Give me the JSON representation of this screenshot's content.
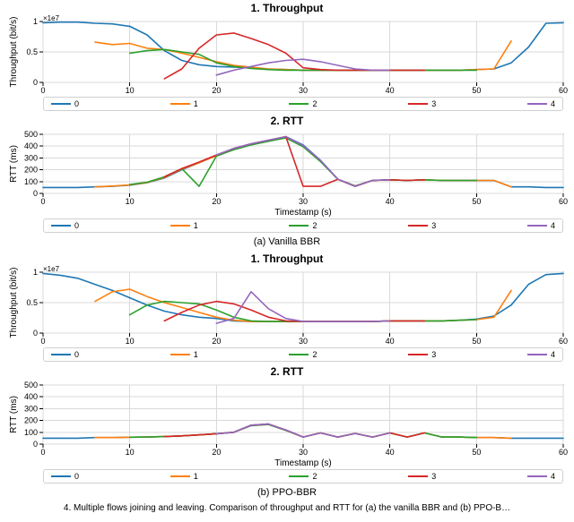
{
  "colors": {
    "s0": "#1f77b4",
    "s1": "#ff7f0e",
    "s2": "#2ca02c",
    "s3": "#d62728",
    "s4": "#9467bd"
  },
  "subcaptions": {
    "a": "(a) Vanilla BBR",
    "b": "(b) PPO-BBR"
  },
  "truncated_line": "4.  Multiple flows joining and leaving.  Comparison of throughput and RTT for (a) the vanilla BBR and (b) PPO-B…",
  "axes": {
    "x_label": "Timestamp (s)",
    "throughput_label": "Throughput (bit/s)",
    "rtt_label": "RTT (ms)",
    "throughput_exp": "1e7"
  },
  "legend_labels": [
    "0",
    "1",
    "2",
    "3",
    "4"
  ],
  "chart_data": [
    {
      "id": "vanilla-throughput",
      "title": "1. Throughput",
      "type": "line",
      "xlabel": "",
      "ylabel": "Throughput (bit/s)",
      "ylim": [
        0,
        10000000
      ],
      "xlim": [
        0,
        60
      ],
      "y_note": "×1e7",
      "x": [
        0,
        2,
        4,
        6,
        8,
        10,
        12,
        14,
        16,
        18,
        20,
        22,
        24,
        26,
        28,
        30,
        32,
        34,
        36,
        38,
        40,
        42,
        44,
        46,
        48,
        50,
        52,
        54,
        56,
        58,
        60
      ],
      "series": [
        {
          "name": "0",
          "color": "s0",
          "values": [
            9.8,
            9.9,
            9.9,
            9.7,
            9.6,
            9.2,
            7.8,
            5.2,
            3.6,
            2.9,
            2.6,
            2.5,
            2.4,
            2.2,
            2.1,
            2.0,
            2.0,
            2.0,
            2.0,
            2.0,
            2.0,
            2.0,
            2.0,
            2.0,
            2.0,
            2.1,
            2.2,
            3.2,
            5.8,
            9.7,
            9.8
          ],
          "scale": 1000000.0
        },
        {
          "name": "1",
          "color": "s1",
          "values": [
            null,
            null,
            null,
            6.6,
            6.2,
            6.4,
            5.6,
            5.4,
            4.8,
            4.1,
            3.4,
            2.8,
            2.5,
            2.2,
            2.1,
            2.0,
            2.0,
            2.0,
            2.0,
            2.0,
            2.0,
            2.0,
            2.0,
            2.0,
            2.0,
            2.1,
            2.2,
            6.8,
            null,
            null,
            null
          ],
          "scale": 1000000.0
        },
        {
          "name": "2",
          "color": "s2",
          "values": [
            null,
            null,
            null,
            null,
            null,
            4.8,
            5.2,
            5.4,
            5.0,
            4.6,
            3.2,
            2.6,
            2.3,
            2.1,
            2.0,
            2.0,
            2.0,
            2.0,
            2.0,
            2.0,
            2.0,
            2.0,
            2.0,
            2.0,
            2.0,
            2.0,
            null,
            null,
            null,
            null,
            null
          ],
          "scale": 1000000.0
        },
        {
          "name": "3",
          "color": "s3",
          "values": [
            null,
            null,
            null,
            null,
            null,
            null,
            null,
            0.6,
            2.2,
            5.6,
            7.8,
            8.1,
            7.2,
            6.2,
            4.8,
            2.4,
            2.1,
            2.0,
            2.0,
            2.0,
            2.0,
            2.0,
            2.0,
            null,
            null,
            null,
            null,
            null,
            null,
            null,
            null
          ],
          "scale": 1000000.0
        },
        {
          "name": "4",
          "color": "s4",
          "values": [
            null,
            null,
            null,
            null,
            null,
            null,
            null,
            null,
            null,
            null,
            1.2,
            2.0,
            2.6,
            3.2,
            3.6,
            3.8,
            3.4,
            2.8,
            2.2,
            2.0,
            2.0,
            null,
            null,
            null,
            null,
            null,
            null,
            null,
            null,
            null,
            null
          ],
          "scale": 1000000.0
        }
      ],
      "yticks": [
        0,
        0.5,
        1.0
      ],
      "ytick_scale": 10000000.0
    },
    {
      "id": "vanilla-rtt",
      "title": "2. RTT",
      "type": "line",
      "xlabel": "Timestamp (s)",
      "ylabel": "RTT (ms)",
      "ylim": [
        0,
        500
      ],
      "xlim": [
        0,
        60
      ],
      "x": [
        0,
        2,
        4,
        6,
        8,
        10,
        12,
        14,
        16,
        18,
        20,
        22,
        24,
        26,
        28,
        30,
        32,
        34,
        36,
        38,
        40,
        42,
        44,
        46,
        48,
        50,
        52,
        54,
        56,
        58,
        60
      ],
      "series": [
        {
          "name": "0",
          "color": "s0",
          "values": [
            50,
            50,
            50,
            55,
            60,
            70,
            90,
            130,
            200,
            260,
            320,
            380,
            420,
            450,
            480,
            410,
            280,
            120,
            60,
            110,
            115,
            110,
            115,
            110,
            110,
            110,
            110,
            55,
            55,
            50,
            50
          ]
        },
        {
          "name": "1",
          "color": "s1",
          "values": [
            null,
            null,
            null,
            55,
            62,
            72,
            92,
            135,
            205,
            260,
            320,
            375,
            415,
            445,
            475,
            400,
            275,
            120,
            62,
            110,
            115,
            110,
            115,
            110,
            110,
            110,
            110,
            55,
            null,
            null,
            null
          ]
        },
        {
          "name": "2",
          "color": "s2",
          "values": [
            null,
            null,
            null,
            null,
            null,
            75,
            95,
            140,
            210,
            60,
            315,
            370,
            410,
            440,
            470,
            395,
            270,
            120,
            64,
            110,
            115,
            110,
            115,
            110,
            110,
            110,
            null,
            null,
            null,
            null,
            null
          ]
        },
        {
          "name": "3",
          "color": "s3",
          "values": [
            null,
            null,
            null,
            null,
            null,
            null,
            null,
            140,
            210,
            265,
            325,
            380,
            420,
            450,
            480,
            60,
            60,
            120,
            60,
            110,
            115,
            110,
            115,
            null,
            null,
            null,
            null,
            null,
            null,
            null,
            null
          ]
        },
        {
          "name": "4",
          "color": "s4",
          "values": [
            null,
            null,
            null,
            null,
            null,
            null,
            null,
            null,
            null,
            null,
            325,
            380,
            420,
            450,
            480,
            405,
            280,
            120,
            60,
            110,
            115,
            null,
            null,
            null,
            null,
            null,
            null,
            null,
            null,
            null,
            null
          ]
        }
      ],
      "yticks": [
        0,
        100,
        200,
        300,
        400,
        500
      ]
    },
    {
      "id": "ppo-throughput",
      "title": "1. Throughput",
      "type": "line",
      "xlabel": "",
      "ylabel": "Throughput (bit/s)",
      "ylim": [
        0,
        10000000
      ],
      "xlim": [
        0,
        60
      ],
      "y_note": "×1e7",
      "x": [
        0,
        2,
        4,
        6,
        8,
        10,
        12,
        14,
        16,
        18,
        20,
        22,
        24,
        26,
        28,
        30,
        32,
        34,
        36,
        38,
        40,
        42,
        44,
        46,
        48,
        50,
        52,
        54,
        56,
        58,
        60
      ],
      "series": [
        {
          "name": "0",
          "color": "s0",
          "values": [
            9.8,
            9.5,
            9.0,
            8.0,
            7.0,
            5.8,
            4.6,
            3.6,
            3.0,
            2.6,
            2.4,
            2.0,
            1.9,
            1.9,
            1.9,
            1.9,
            1.9,
            1.9,
            1.9,
            1.9,
            2.0,
            2.0,
            2.0,
            2.0,
            2.1,
            2.3,
            2.8,
            4.6,
            8.0,
            9.6,
            9.8
          ],
          "scale": 1000000.0
        },
        {
          "name": "1",
          "color": "s1",
          "values": [
            null,
            null,
            null,
            5.2,
            6.8,
            7.2,
            6.0,
            5.0,
            4.2,
            3.4,
            2.6,
            2.1,
            1.9,
            1.9,
            1.9,
            1.9,
            1.9,
            1.9,
            1.9,
            1.9,
            2.0,
            2.0,
            2.0,
            2.0,
            2.1,
            2.2,
            2.6,
            7.0,
            null,
            null,
            null
          ],
          "scale": 1000000.0
        },
        {
          "name": "2",
          "color": "s2",
          "values": [
            null,
            null,
            null,
            null,
            null,
            3.0,
            4.6,
            5.2,
            5.0,
            4.8,
            3.8,
            2.6,
            2.0,
            1.9,
            1.9,
            1.9,
            1.9,
            1.9,
            1.9,
            1.9,
            2.0,
            2.0,
            2.0,
            2.0,
            2.1,
            2.2,
            null,
            null,
            null,
            null,
            null
          ],
          "scale": 1000000.0
        },
        {
          "name": "3",
          "color": "s3",
          "values": [
            null,
            null,
            null,
            null,
            null,
            null,
            null,
            2.0,
            3.4,
            4.6,
            5.2,
            4.8,
            3.8,
            2.6,
            2.0,
            1.9,
            1.9,
            1.9,
            1.9,
            1.9,
            2.0,
            2.0,
            2.0,
            null,
            null,
            null,
            null,
            null,
            null,
            null,
            null
          ],
          "scale": 1000000.0
        },
        {
          "name": "4",
          "color": "s4",
          "values": [
            null,
            null,
            null,
            null,
            null,
            null,
            null,
            null,
            null,
            null,
            1.6,
            2.4,
            6.8,
            4.0,
            2.4,
            1.9,
            1.9,
            1.9,
            1.9,
            1.9,
            2.0,
            null,
            null,
            null,
            null,
            null,
            null,
            null,
            null,
            null,
            null
          ],
          "scale": 1000000.0
        }
      ],
      "yticks": [
        0,
        0.5,
        1.0
      ],
      "ytick_scale": 10000000.0
    },
    {
      "id": "ppo-rtt",
      "title": "2. RTT",
      "type": "line",
      "xlabel": "Timestamp (s)",
      "ylabel": "RTT (ms)",
      "ylim": [
        0,
        500
      ],
      "xlim": [
        0,
        60
      ],
      "x": [
        0,
        2,
        4,
        6,
        8,
        10,
        12,
        14,
        16,
        18,
        20,
        22,
        24,
        26,
        28,
        30,
        32,
        34,
        36,
        38,
        40,
        42,
        44,
        46,
        48,
        50,
        52,
        54,
        56,
        58,
        60
      ],
      "series": [
        {
          "name": "0",
          "color": "s0",
          "values": [
            50,
            50,
            50,
            55,
            55,
            58,
            60,
            64,
            70,
            78,
            88,
            100,
            160,
            170,
            120,
            60,
            95,
            60,
            90,
            60,
            95,
            60,
            95,
            60,
            60,
            55,
            55,
            50,
            50,
            50,
            50
          ]
        },
        {
          "name": "1",
          "color": "s1",
          "values": [
            null,
            null,
            null,
            55,
            55,
            58,
            60,
            64,
            70,
            78,
            88,
            100,
            158,
            168,
            118,
            60,
            95,
            60,
            90,
            60,
            95,
            60,
            95,
            60,
            60,
            55,
            55,
            50,
            null,
            null,
            null
          ]
        },
        {
          "name": "2",
          "color": "s2",
          "values": [
            null,
            null,
            null,
            null,
            null,
            58,
            60,
            64,
            70,
            78,
            88,
            100,
            156,
            166,
            116,
            60,
            95,
            60,
            90,
            60,
            95,
            60,
            95,
            60,
            60,
            55,
            null,
            null,
            null,
            null,
            null
          ]
        },
        {
          "name": "3",
          "color": "s3",
          "values": [
            null,
            null,
            null,
            null,
            null,
            null,
            null,
            64,
            70,
            78,
            88,
            100,
            160,
            170,
            120,
            60,
            95,
            60,
            90,
            60,
            95,
            60,
            95,
            null,
            null,
            null,
            null,
            null,
            null,
            null,
            null
          ]
        },
        {
          "name": "4",
          "color": "s4",
          "values": [
            null,
            null,
            null,
            null,
            null,
            null,
            null,
            null,
            null,
            null,
            88,
            100,
            160,
            170,
            120,
            60,
            95,
            60,
            90,
            60,
            95,
            null,
            null,
            null,
            null,
            null,
            null,
            null,
            null,
            null,
            null
          ]
        }
      ],
      "yticks": [
        0,
        100,
        200,
        300,
        400,
        500
      ]
    }
  ]
}
